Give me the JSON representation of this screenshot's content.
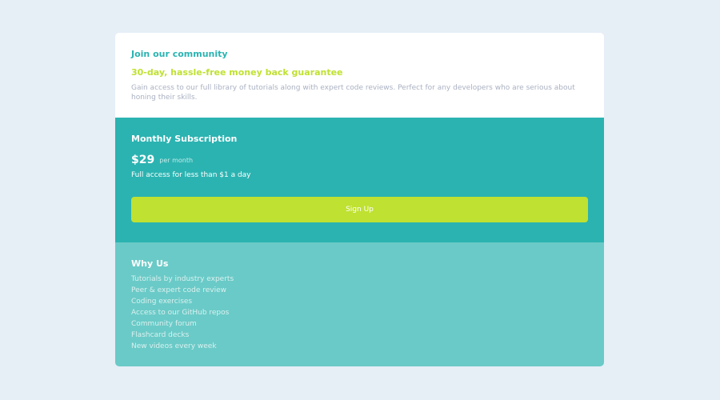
{
  "community": {
    "title": "Join our community",
    "subtitle": "30-day, hassle-free money back guarantee",
    "description": "Gain access to our full library of tutorials along with expert code reviews. Perfect for any developers who are serious about honing their skills."
  },
  "subscription": {
    "title": "Monthly Subscription",
    "price": "$29",
    "period": "per month",
    "access_text": "Full access for less than $1 a day",
    "signup_label": "Sign Up"
  },
  "why": {
    "title": "Why Us",
    "items": [
      "Tutorials by industry experts",
      "Peer & expert code review",
      "Coding exercises",
      "Access to our GitHub repos",
      "Community forum",
      "Flashcard decks",
      "New videos every week"
    ]
  },
  "colors": {
    "background": "#e6eef6",
    "teal": "#2bb3b1",
    "light_teal": "#6acac7",
    "lime": "#bfe131",
    "gray_text": "#aab1c2"
  }
}
